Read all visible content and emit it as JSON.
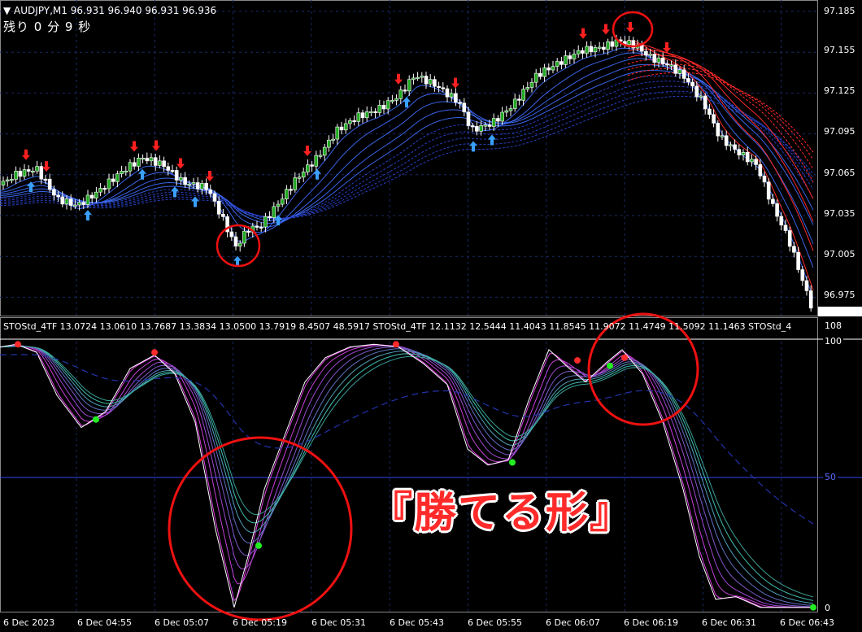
{
  "header": {
    "symbol_text": "▼ AUDJPY,M1  96.931 96.940 96.931 96.936",
    "countdown": "残り 0 分 9 秒"
  },
  "subwindow": {
    "indicator_text": "STOStd_4TF 13.0724 13.0610 13.7687 13.3834 13.0500 13.7919 8.4507 48.5917   STOStd_4TF 12.1132 12.5444 11.4043 11.8545 11.9072 11.4749 11.5092 11.1463   STOStd_4"
  },
  "price_axis": [
    "97.185",
    "97.155",
    "97.125",
    "97.095",
    "97.065",
    "97.035",
    "97.005",
    "96.975"
  ],
  "sub_axis": {
    "top": "108",
    "high": "100",
    "mid": "50",
    "low": "0"
  },
  "time_axis": [
    "6 Dec 2023",
    "6 Dec 04:55",
    "6 Dec 05:07",
    "6 Dec 05:19",
    "6 Dec 05:31",
    "6 Dec 05:43",
    "6 Dec 05:55",
    "6 Dec 06:07",
    "6 Dec 06:19",
    "6 Dec 06:31",
    "6 Dec 06:43"
  ],
  "caption": "『勝てる形』",
  "colors": {
    "background": "#000000",
    "bull_candle": "#22aa22",
    "bear_candle": "#ffffff",
    "up_arrow": "#3aa0ff",
    "down_arrow": "#ff2020",
    "annotation_circle": "#ee1111",
    "grid": "#1a2a66",
    "ma_red": "#ff2a2a",
    "ma_blue": "#3f6fff",
    "stoch_magenta": "#e040e0",
    "stoch_teal": "#40c0b0"
  },
  "chart_data": {
    "type": "line",
    "symbol": "AUDJPY,M1",
    "ylim": [
      96.965,
      97.19
    ],
    "close_path": [
      [
        0,
        97.06
      ],
      [
        20,
        97.068
      ],
      [
        45,
        97.072
      ],
      [
        70,
        97.05
      ],
      [
        95,
        97.045
      ],
      [
        120,
        97.055
      ],
      [
        150,
        97.07
      ],
      [
        175,
        97.08
      ],
      [
        200,
        97.075
      ],
      [
        225,
        97.062
      ],
      [
        255,
        97.058
      ],
      [
        270,
        97.04
      ],
      [
        290,
        97.015
      ],
      [
        305,
        97.028
      ],
      [
        320,
        97.03
      ],
      [
        340,
        97.045
      ],
      [
        365,
        97.065
      ],
      [
        390,
        97.08
      ],
      [
        415,
        97.1
      ],
      [
        440,
        97.11
      ],
      [
        465,
        97.115
      ],
      [
        490,
        97.125
      ],
      [
        510,
        97.14
      ],
      [
        535,
        97.133
      ],
      [
        565,
        97.12
      ],
      [
        580,
        97.1
      ],
      [
        605,
        97.105
      ],
      [
        630,
        97.118
      ],
      [
        660,
        97.14
      ],
      [
        690,
        97.15
      ],
      [
        715,
        97.158
      ],
      [
        740,
        97.16
      ],
      [
        760,
        97.165
      ],
      [
        780,
        97.162
      ],
      [
        800,
        97.153
      ],
      [
        820,
        97.148
      ],
      [
        840,
        97.14
      ],
      [
        865,
        97.12
      ],
      [
        885,
        97.095
      ],
      [
        905,
        97.085
      ],
      [
        930,
        97.075
      ],
      [
        950,
        97.045
      ],
      [
        970,
        97.02
      ],
      [
        990,
        96.985
      ],
      [
        1000,
        96.968
      ]
    ],
    "sub_ylim": [
      0,
      108
    ],
    "stoch_path": [
      [
        0,
        98
      ],
      [
        20,
        99
      ],
      [
        45,
        96
      ],
      [
        70,
        80
      ],
      [
        100,
        68
      ],
      [
        130,
        74
      ],
      [
        160,
        90
      ],
      [
        190,
        95
      ],
      [
        215,
        88
      ],
      [
        240,
        70
      ],
      [
        265,
        30
      ],
      [
        288,
        1
      ],
      [
        305,
        20
      ],
      [
        325,
        45
      ],
      [
        350,
        65
      ],
      [
        375,
        85
      ],
      [
        400,
        94
      ],
      [
        430,
        98
      ],
      [
        460,
        99
      ],
      [
        490,
        98
      ],
      [
        520,
        92
      ],
      [
        550,
        84
      ],
      [
        575,
        60
      ],
      [
        600,
        54
      ],
      [
        625,
        56
      ],
      [
        650,
        78
      ],
      [
        675,
        97
      ],
      [
        700,
        90
      ],
      [
        720,
        85
      ],
      [
        745,
        92
      ],
      [
        765,
        97
      ],
      [
        790,
        88
      ],
      [
        815,
        70
      ],
      [
        840,
        45
      ],
      [
        860,
        20
      ],
      [
        880,
        4
      ],
      [
        905,
        5
      ],
      [
        935,
        1
      ],
      [
        965,
        1
      ],
      [
        1000,
        1
      ]
    ]
  }
}
